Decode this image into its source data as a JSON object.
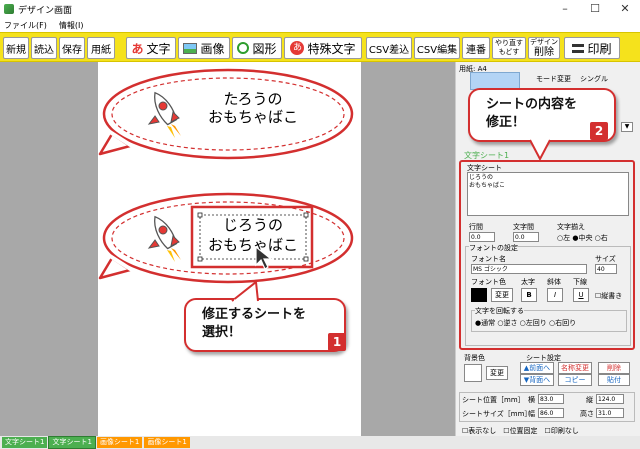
{
  "window": {
    "title": "デザイン画面",
    "min": "–",
    "max": "☐",
    "close": "✕"
  },
  "menu": [
    "ファイル(F)",
    "情報(I)"
  ],
  "toolbar": {
    "new": "新規",
    "open": "読込",
    "save": "保存",
    "paper": "用紙",
    "text": "文字",
    "image": "画像",
    "shape": "図形",
    "special_text": "特殊文字",
    "csv_insert": "CSV差込",
    "csv_edit": "CSV編集",
    "serial": "連番",
    "redo": "やり直す",
    "undo": "もどす",
    "design": "デザイン",
    "delete": "削除",
    "print": "印刷",
    "text_icon": "あ",
    "special_icon": "あ"
  },
  "canvas": {
    "sheet1": {
      "line1": "たろうの",
      "line2": "おもちゃばこ"
    },
    "sheet2": {
      "line1": "じろうの",
      "line2": "おもちゃばこ"
    }
  },
  "callouts": {
    "bottom": {
      "line1": "修正するシートを",
      "line2": "選択！",
      "badge": "1"
    },
    "top": {
      "line1": "シートの内容を",
      "line2": "修正！",
      "badge": "2"
    }
  },
  "panel": {
    "paper_label": "用紙: A4",
    "mode_change": "モード変更",
    "single": "シングル",
    "section_title": "文字シート1",
    "text_sheet_group": "文字シート",
    "text_content_line1": "じろうの",
    "text_content_line2": "おもちゃばこ",
    "line_spacing": "行間",
    "line_spacing_val": "0.0",
    "char_spacing": "文字間",
    "char_spacing_val": "0.0",
    "align": "文字揃え",
    "align_left": "左",
    "align_center": "中央",
    "align_right": "右",
    "font_settings": "フォントの設定",
    "font_name": "フォント名",
    "font_value": "MS ゴシック",
    "size": "サイズ",
    "size_value": "40",
    "font_color": "フォント色",
    "bold_label": "太字",
    "italic_label": "斜体",
    "underline_label": "下線",
    "change": "変更",
    "bold": "B",
    "italic": "I",
    "underline": "U",
    "vertical": "縦書き",
    "rotate": "文字を回転する",
    "rot_normal": "通常",
    "rot_reverse": "逆さ",
    "rot_left": "左回り",
    "rot_right": "右回り",
    "bg_color": "背景色",
    "bg_change": "変更",
    "sheet_settings": "シート設定",
    "to_front": "▲前面へ",
    "to_back": "▼背面へ",
    "rename": "名称変更",
    "copy": "コピー",
    "delete": "削除",
    "paste": "貼付",
    "position": "シート位置［mm］",
    "pos_x_label": "横",
    "pos_x": "83.0",
    "pos_y_label": "縦",
    "pos_y": "124.0",
    "size_label": "シートサイズ［mm］",
    "width_label": "幅",
    "width": "86.0",
    "height_label": "高さ",
    "height": "31.0",
    "hide": "表示なし",
    "lock": "位置固定",
    "no_print": "印刷なし"
  },
  "bottom_tabs": [
    {
      "label": "文字シート1",
      "color": "#4caf50"
    },
    {
      "label": "文字シート1",
      "color": "#4caf50"
    },
    {
      "label": "画像シート1",
      "color": "#ff9800"
    },
    {
      "label": "画像シート1",
      "color": "#ff9800"
    }
  ]
}
